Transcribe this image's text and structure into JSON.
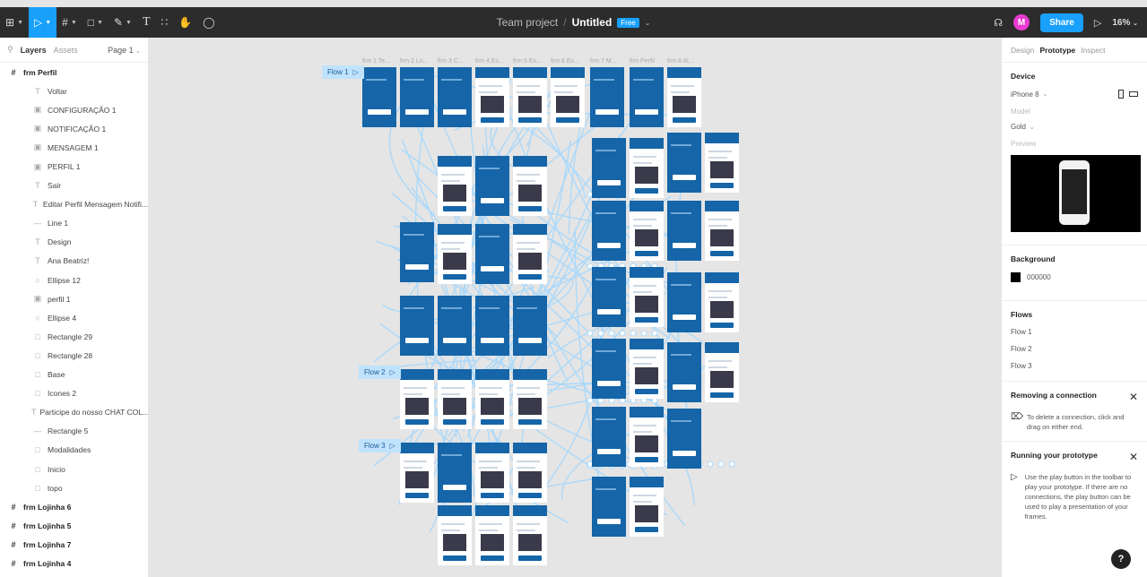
{
  "toolbar": {
    "team": "Team project",
    "separator": "/",
    "file_name": "Untitled",
    "plan_badge": "Free",
    "avatar_initial": "M",
    "share_label": "Share",
    "zoom": "16%"
  },
  "left_panel": {
    "tab_layers": "Layers",
    "tab_assets": "Assets",
    "page": "Page 1",
    "layers": [
      {
        "label": "frm Perfil",
        "kind": "frame",
        "depth": 0
      },
      {
        "label": "Voltar",
        "kind": "text",
        "depth": 1
      },
      {
        "label": "CONFIGURAÇÃO 1",
        "kind": "image",
        "depth": 1
      },
      {
        "label": "NOTIFICAÇÃO 1",
        "kind": "image",
        "depth": 1
      },
      {
        "label": "MENSAGEM 1",
        "kind": "image",
        "depth": 1
      },
      {
        "label": "PERFIL 1",
        "kind": "image",
        "depth": 1
      },
      {
        "label": "Sair",
        "kind": "text",
        "depth": 1
      },
      {
        "label": "Editar Perfil Mensagem Notifi...",
        "kind": "text",
        "depth": 1
      },
      {
        "label": "Line 1",
        "kind": "line",
        "depth": 1
      },
      {
        "label": "Design",
        "kind": "text",
        "depth": 1
      },
      {
        "label": "Ana Beatriz!",
        "kind": "text",
        "depth": 1
      },
      {
        "label": "Ellipse 12",
        "kind": "ellipse",
        "depth": 1
      },
      {
        "label": "perfil 1",
        "kind": "image",
        "depth": 1
      },
      {
        "label": "Ellipse 4",
        "kind": "ellipse",
        "depth": 1
      },
      {
        "label": "Rectangle 29",
        "kind": "rect",
        "depth": 1
      },
      {
        "label": "Rectangle 28",
        "kind": "rect",
        "depth": 1
      },
      {
        "label": "Base",
        "kind": "rect",
        "depth": 1
      },
      {
        "label": "Icones 2",
        "kind": "rect",
        "depth": 1
      },
      {
        "label": "Participe do nosso CHAT COL...",
        "kind": "text",
        "depth": 1
      },
      {
        "label": "Rectangle 5",
        "kind": "line",
        "depth": 1
      },
      {
        "label": "Modalidades",
        "kind": "rect",
        "depth": 1
      },
      {
        "label": "Inicio",
        "kind": "rect",
        "depth": 1
      },
      {
        "label": "topo",
        "kind": "rect",
        "depth": 1
      },
      {
        "label": "frm Lojinha 6",
        "kind": "frame",
        "depth": 0
      },
      {
        "label": "frm Lojinha 5",
        "kind": "frame",
        "depth": 0
      },
      {
        "label": "frm Lojinha 7",
        "kind": "frame",
        "depth": 0
      },
      {
        "label": "frm Lojinha 4",
        "kind": "frame",
        "depth": 0
      }
    ]
  },
  "canvas": {
    "flows": [
      "Flow 1",
      "Flow 2",
      "Flow 3"
    ],
    "frame_labels_top": [
      "frm 1 Te...",
      "frm 2 Lo...",
      "frm 3 C...",
      "frm 4 Es...",
      "frm 5 Es...",
      "frm 6 Es...",
      "frm 7 M...",
      "frm Perfil",
      "frm 8 Al..."
    ]
  },
  "right_panel": {
    "tabs": [
      "Design",
      "Prototype",
      "Inspect"
    ],
    "active_tab": "Prototype",
    "device_title": "Device",
    "device": "iPhone 8",
    "model_label": "Model",
    "model": "Gold",
    "preview_label": "Preview",
    "background_title": "Background",
    "background_hex": "000000",
    "flows_title": "Flows",
    "flows": [
      "Flow 1",
      "Flow 2",
      "Flow 3"
    ],
    "tip1_title": "Removing a connection",
    "tip1_text": "To delete a connection, click and drag on either end.",
    "tip2_title": "Running your prototype",
    "tip2_text": "Use the play button in the toolbar to play your prototype. If there are no connections, the play button can be used to play a presentation of your frames."
  },
  "colors": {
    "accent": "#18a0fb",
    "toolbar_bg": "#2c2c2c",
    "frame_blue": "#1565a8",
    "connection": "#a8d8fb"
  },
  "help_label": "?"
}
